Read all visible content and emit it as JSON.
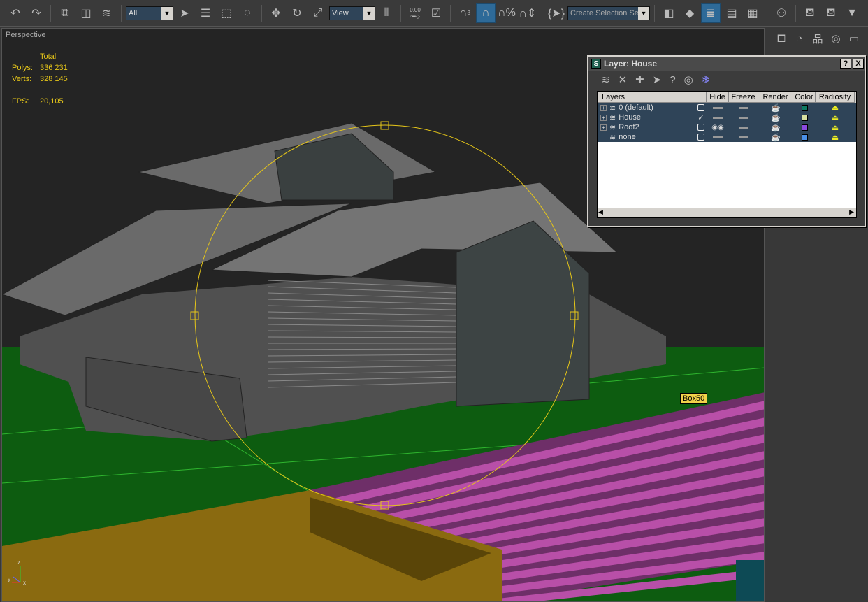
{
  "toolbar": {
    "selection_filter": "All",
    "reference_coord": "View",
    "spinner_snap_value": "0.00",
    "named_selection_placeholder": "Create Selection Set",
    "snap_label": "3"
  },
  "viewport": {
    "label": "Perspective",
    "stats": {
      "header": "Total",
      "polys_label": "Polys:",
      "polys": "336 231",
      "verts_label": "Verts:",
      "verts": "328 145",
      "fps_label": "FPS:",
      "fps": "20,105"
    },
    "tooltip": "Box50",
    "colors": {
      "background": "#242424",
      "ground": "#0d5c10",
      "grid_line": "#2fb52f",
      "stripes": "#b84fa8",
      "selected_box": "#8a6a10",
      "gizmo": "#e6c619"
    }
  },
  "layer_dialog": {
    "title": "Layer: House",
    "help": "?",
    "close": "X",
    "columns": [
      "Layers",
      "",
      "Hide",
      "Freeze",
      "Render",
      "Color",
      "Radiosity"
    ],
    "layers": [
      {
        "name": "0 (default)",
        "expandable": true,
        "current": false,
        "hidden": false,
        "color": "#0e7a62"
      },
      {
        "name": "House",
        "expandable": true,
        "current": true,
        "hidden": false,
        "color": "#d8e0a0"
      },
      {
        "name": "Roof2",
        "expandable": true,
        "current": false,
        "hidden": true,
        "color": "#8a4ae0"
      },
      {
        "name": "none",
        "expandable": false,
        "current": false,
        "hidden": false,
        "color": "#4a90e8"
      }
    ]
  }
}
